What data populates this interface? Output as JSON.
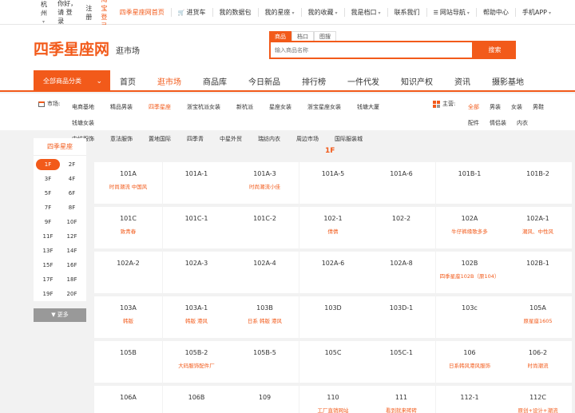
{
  "topbar": {
    "city": "杭州",
    "greeting": "你好，请 登录",
    "register": "注册",
    "taobao_login": "淘宝登录",
    "links": [
      {
        "label": "四季星座网首页",
        "orange": true,
        "caret": false
      },
      {
        "label": "进货车",
        "orange": false,
        "caret": false,
        "icon": "cart-icon"
      },
      {
        "label": "我的数据包",
        "orange": false,
        "caret": false
      },
      {
        "label": "我的星座",
        "orange": false,
        "caret": true
      },
      {
        "label": "我的收藏",
        "orange": false,
        "caret": true
      },
      {
        "label": "我是档口",
        "orange": false,
        "caret": true
      },
      {
        "label": "联系我们",
        "orange": false,
        "caret": false
      },
      {
        "label": "网站导航",
        "orange": false,
        "caret": true,
        "icon": "menu-icon"
      },
      {
        "label": "帮助中心",
        "orange": false,
        "caret": false
      },
      {
        "label": "手机APP",
        "orange": false,
        "caret": true
      }
    ]
  },
  "header": {
    "logo": "四季星座网",
    "subtitle": "逛市场",
    "search_tabs": [
      "商品",
      "档口",
      "图搜"
    ],
    "search_placeholder": "输入商品名称",
    "search_button": "搜索"
  },
  "nav": {
    "category_label": "全部商品分类",
    "links": [
      "首页",
      "逛市场",
      "商品库",
      "今日新品",
      "排行榜",
      "一件代发",
      "知识产权",
      "资讯",
      "摄影基地"
    ],
    "active_index": 1
  },
  "filter": {
    "market_label": "市场:",
    "markets": [
      "电商基地",
      "精品男装",
      "四季星座",
      "浙宝杭派女装",
      "新杭派",
      "星座女装",
      "浙宝星座女装",
      "钱塘大厦",
      "钱塘女装",
      "中纺服饰",
      "意法服饰",
      "置地国际",
      "四季青",
      "中星外贸",
      "瑞纺内衣",
      "周边市场",
      "国际服装城"
    ],
    "active_market": 2,
    "category_label": "主营:",
    "categories": [
      "全部",
      "男装",
      "女装",
      "男鞋",
      "配件",
      "情侣装",
      "内衣"
    ],
    "active_category": 0
  },
  "floors": {
    "title": "四季星座",
    "items": [
      "1F",
      "2F",
      "3F",
      "4F",
      "5F",
      "6F",
      "7F",
      "8F",
      "9F",
      "10F",
      "11F",
      "12F",
      "13F",
      "14F",
      "15F",
      "16F",
      "17F",
      "18F",
      "19F",
      "20F"
    ],
    "active": 0,
    "more_label": "▼ 更多"
  },
  "floor_label": "1F",
  "stalls": [
    {
      "code": "101A",
      "shop": "时尚潮流 中国风"
    },
    {
      "code": "101A-1",
      "shop": ""
    },
    {
      "code": "101A-3",
      "shop": "时尚潮流小佳"
    },
    {
      "code": "101A-5",
      "shop": ""
    },
    {
      "code": "101A-6",
      "shop": ""
    },
    {
      "code": "101B-1",
      "shop": ""
    },
    {
      "code": "101B-2",
      "shop": ""
    },
    {
      "code": "101C",
      "shop": "致青春"
    },
    {
      "code": "101C-1",
      "shop": ""
    },
    {
      "code": "101C-2",
      "shop": ""
    },
    {
      "code": "102-1",
      "shop": "倩倩"
    },
    {
      "code": "102-2",
      "shop": ""
    },
    {
      "code": "102A",
      "shop": "牛仔裤缘歌多多"
    },
    {
      "code": "102A-1",
      "shop": "潮风、中性风"
    },
    {
      "code": "102A-2",
      "shop": ""
    },
    {
      "code": "102A-3",
      "shop": ""
    },
    {
      "code": "102A-4",
      "shop": ""
    },
    {
      "code": "102A-6",
      "shop": ""
    },
    {
      "code": "102A-8",
      "shop": ""
    },
    {
      "code": "102B",
      "shop": "四季星座102B（原104）"
    },
    {
      "code": "102B-1",
      "shop": ""
    },
    {
      "code": "103A",
      "shop": "韩版"
    },
    {
      "code": "103A-1",
      "shop": "韩版 港风"
    },
    {
      "code": "103B",
      "shop": "日系 韩版 港风"
    },
    {
      "code": "103D",
      "shop": ""
    },
    {
      "code": "103D-1",
      "shop": ""
    },
    {
      "code": "103c",
      "shop": ""
    },
    {
      "code": "105A",
      "shop": "原星座1605"
    },
    {
      "code": "105B",
      "shop": ""
    },
    {
      "code": "105B-2",
      "shop": "大码服饰配件厂"
    },
    {
      "code": "105B-5",
      "shop": ""
    },
    {
      "code": "105C",
      "shop": ""
    },
    {
      "code": "105C-1",
      "shop": ""
    },
    {
      "code": "106",
      "shop": "日系韩风港风服饰"
    },
    {
      "code": "106-2",
      "shop": "时尚潮流"
    },
    {
      "code": "106A",
      "shop": ""
    },
    {
      "code": "106B",
      "shop": ""
    },
    {
      "code": "109",
      "shop": ""
    },
    {
      "code": "110",
      "shop": "工厂直销网站"
    },
    {
      "code": "111",
      "shop": "看到就来砖砖"
    },
    {
      "code": "112-1",
      "shop": ""
    },
    {
      "code": "112C",
      "shop": "原创+设计+潮流"
    }
  ]
}
